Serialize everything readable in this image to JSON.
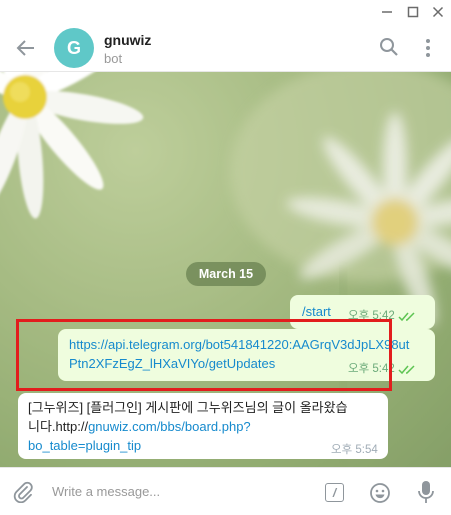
{
  "header": {
    "avatar_letter": "G",
    "chat_name": "gnuwiz",
    "status": "bot"
  },
  "chat": {
    "date_label": "March 15",
    "messages": [
      {
        "direction": "outgoing",
        "text": "/start",
        "time": "오후 5:42",
        "read": true
      },
      {
        "direction": "outgoing",
        "line1": "https://api.telegram.org/bot541841220:AAGrqV3dJpLX98ut",
        "line2": "Ptn2XFzEgZ_lHXaVIYo/getUpdates",
        "time": "오후 5:42",
        "read": true
      },
      {
        "direction": "incoming",
        "line1": "[그누위즈] [플러그인] 게시판에 그누위즈님의 글이 올라왔습",
        "line2_prefix": "니다.http://",
        "line2_link": "gnuwiz.com/bbs/board.php?",
        "line3_link": "bo_table=plugin_tip",
        "time": "오후 5:54"
      }
    ]
  },
  "composer": {
    "placeholder": "Write a message...",
    "command_glyph": "/"
  },
  "colors": {
    "accent": "#168acd",
    "outgoing_bubble": "#effdde",
    "avatar": "#5fc8c8",
    "highlight_border": "#e21d1d"
  }
}
